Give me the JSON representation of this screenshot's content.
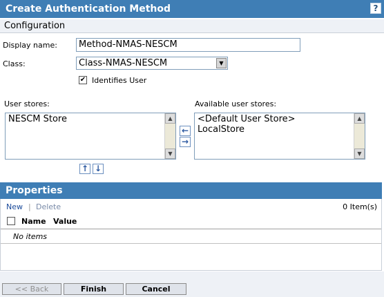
{
  "header": {
    "title": "Create Authentication Method",
    "help_label": "?"
  },
  "section": {
    "configuration": "Configuration"
  },
  "form": {
    "display_name_label": "Display name:",
    "display_name_value": "Method-NMAS-NESCM",
    "class_label": "Class:",
    "class_value": "Class-NMAS-NESCM",
    "identifies_user_label": "Identifies User",
    "identifies_user_checked": true
  },
  "stores": {
    "user_stores_label": "User stores:",
    "user_stores": [
      "NESCM Store"
    ],
    "available_label": "Available user stores:",
    "available_stores": [
      "<Default User Store>",
      "LocalStore"
    ]
  },
  "properties": {
    "title": "Properties",
    "new_label": "New",
    "separator": "|",
    "delete_label": "Delete",
    "item_count": "0 Item(s)",
    "columns": [
      "Name",
      "Value"
    ],
    "empty_text": "No items"
  },
  "footer": {
    "back_label": "<< Back",
    "finish_label": "Finish",
    "cancel_label": "Cancel"
  },
  "colors": {
    "accent": "#3f7eb5",
    "panel": "#eef1f6"
  }
}
